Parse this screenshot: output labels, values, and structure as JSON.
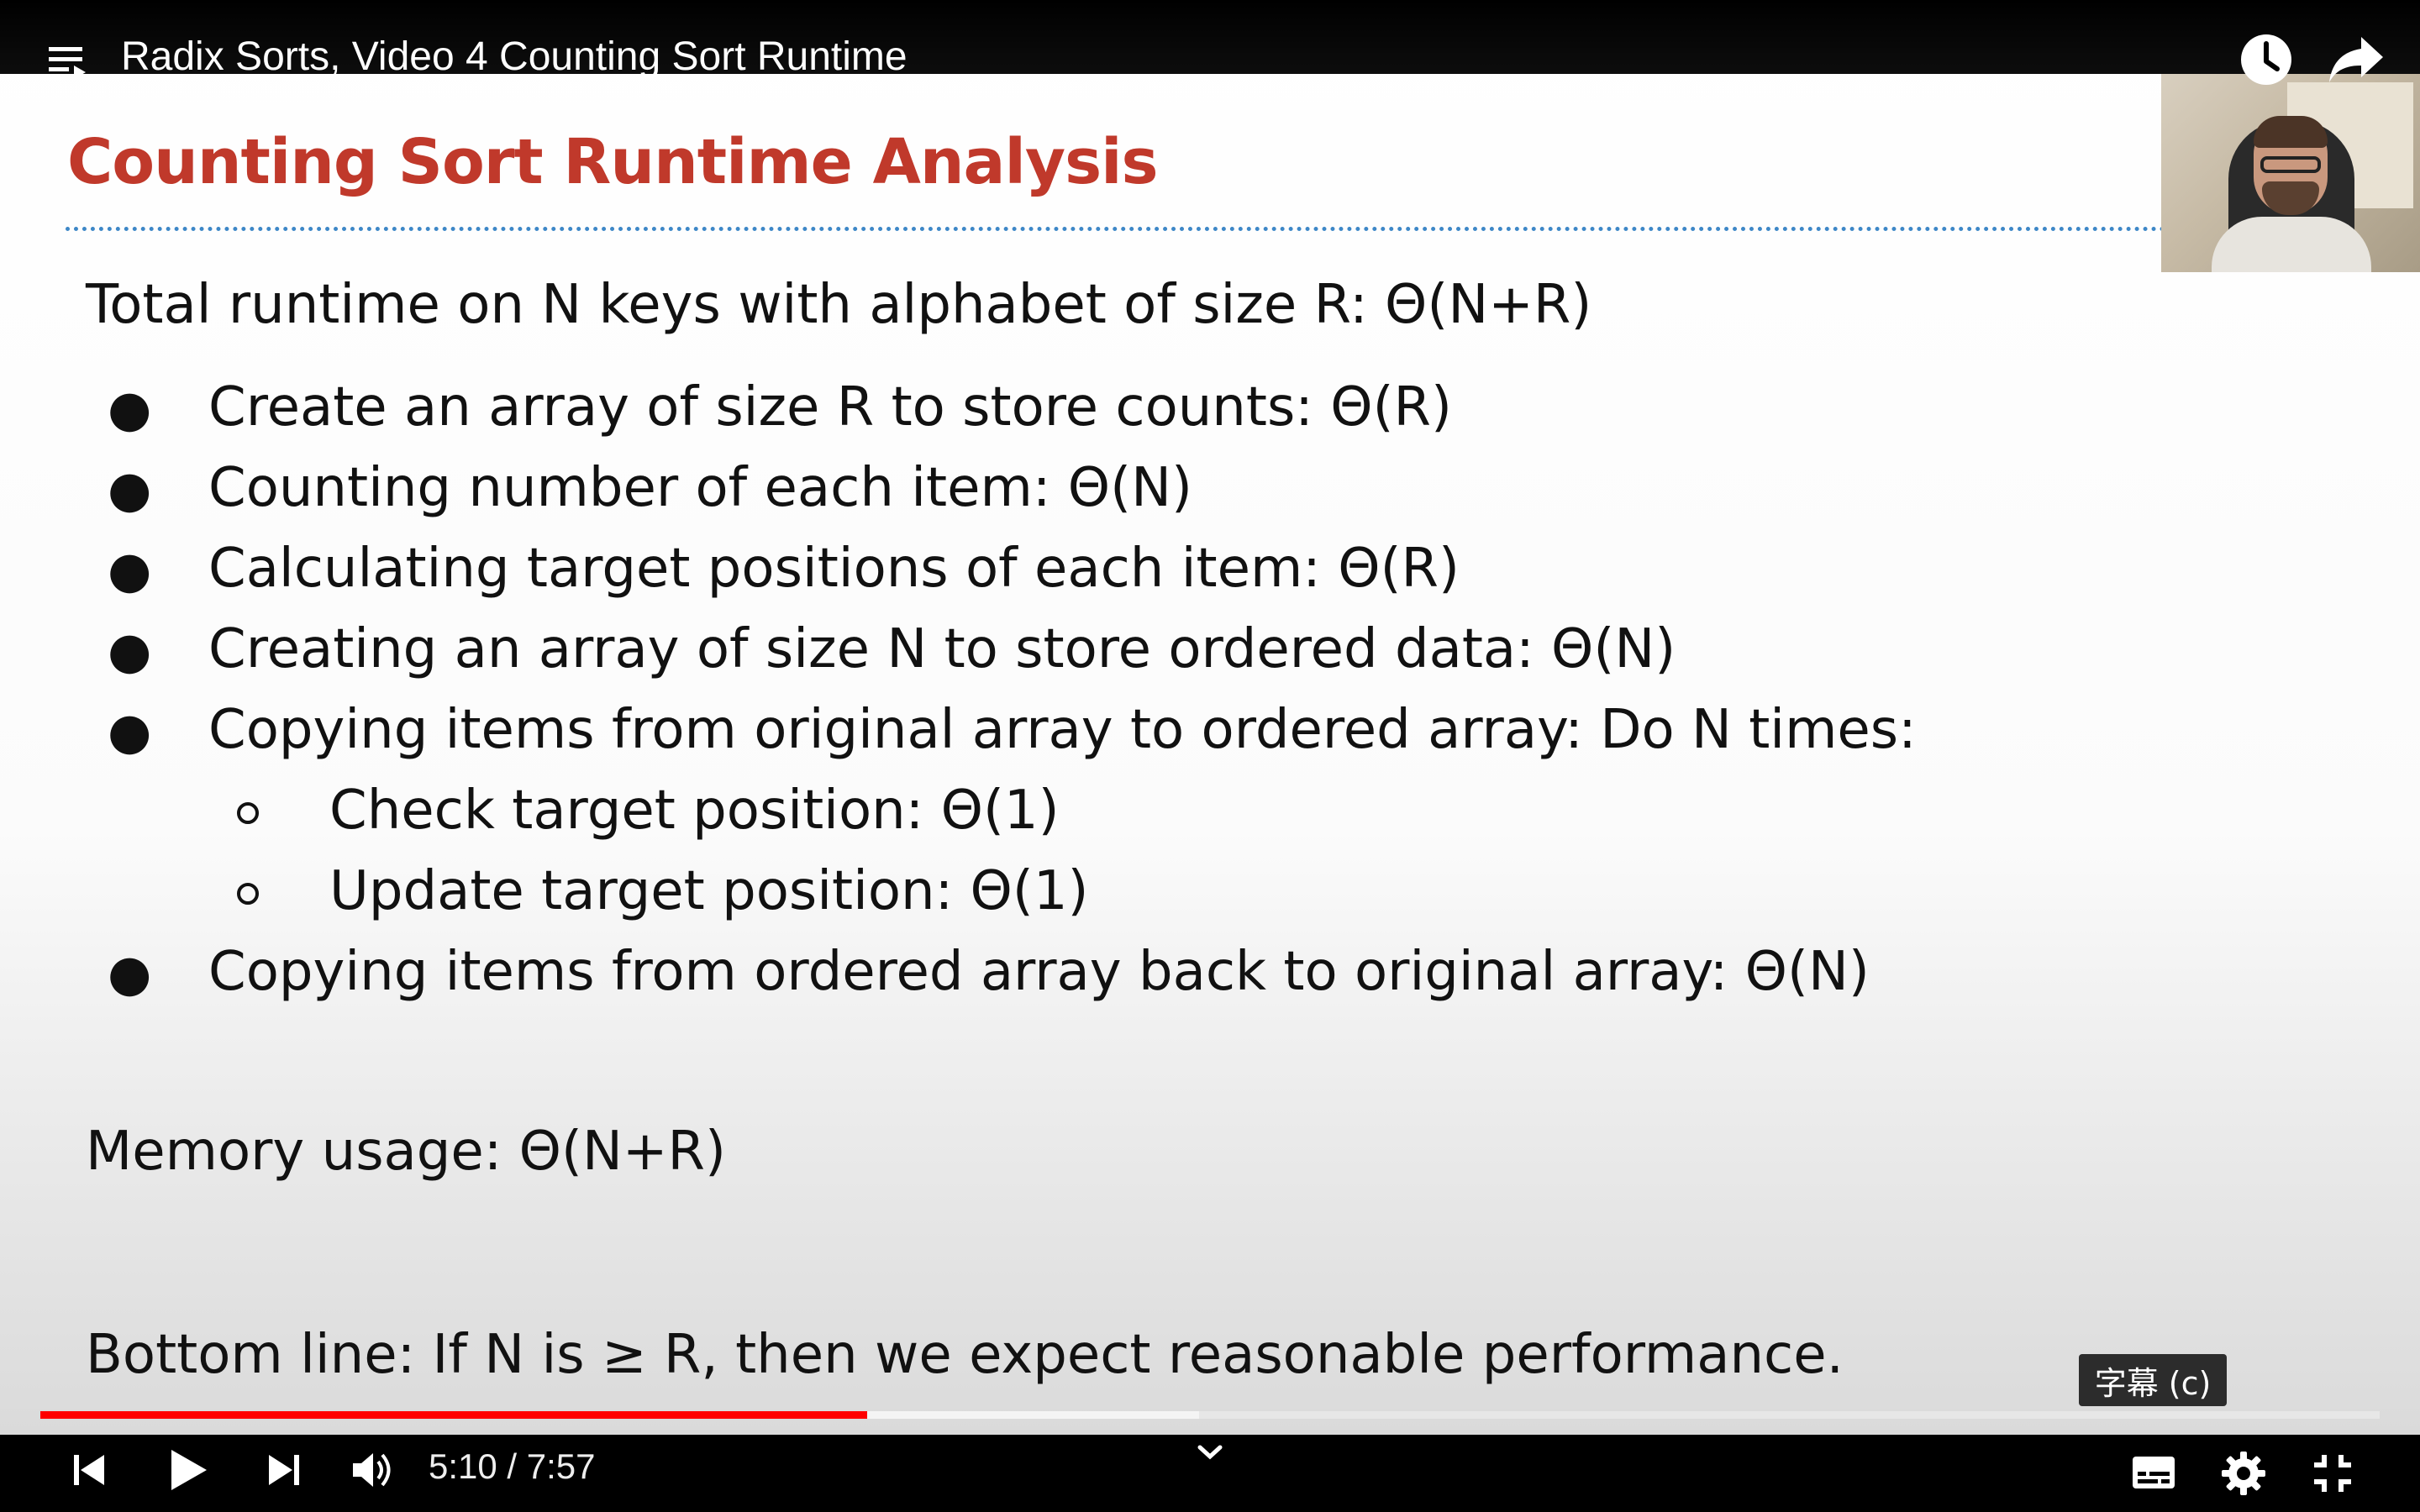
{
  "header": {
    "video_title": "Radix Sorts, Video 4 Counting Sort Runtime"
  },
  "slide": {
    "title": "Counting Sort Runtime Analysis",
    "total_runtime": "Total runtime on N keys with alphabet of size R: Θ(N+R)",
    "bullets": [
      "Create an array of size R to store counts: Θ(R)",
      "Counting number of each item: Θ(N)",
      "Calculating target positions of each item: Θ(R)",
      "Creating an array of size N to store ordered data: Θ(N)",
      "Copying items from original array to ordered array: Do N times:",
      "Copying items from ordered array back to original array: Θ(N)"
    ],
    "sub_bullets": [
      "Check target position: Θ(1)",
      "Update target position: Θ(1)"
    ],
    "memory_usage": "Memory usage: Θ(N+R)",
    "bottom_line": "Bottom line: If N is ≥ R, then we expect reasonable performance."
  },
  "player": {
    "time_display": "5:10 / 7:57",
    "caption_tooltip": "字幕 (c)",
    "progress_played": 0.3535,
    "progress_buffered": 0.4953,
    "colors": {
      "progress": "#ff0000",
      "title_red": "#c0392b",
      "rule_blue": "#3d87c7"
    }
  },
  "icons": {
    "playlist": "playlist-icon",
    "watch_later": "clock-icon",
    "share": "share-arrow-icon",
    "previous": "skip-previous-icon",
    "play": "play-icon",
    "next": "skip-next-icon",
    "volume": "volume-icon",
    "chevron": "chevron-down-icon",
    "subtitles": "subtitles-icon",
    "settings": "gear-icon",
    "exit_fullscreen": "exit-fullscreen-icon"
  }
}
